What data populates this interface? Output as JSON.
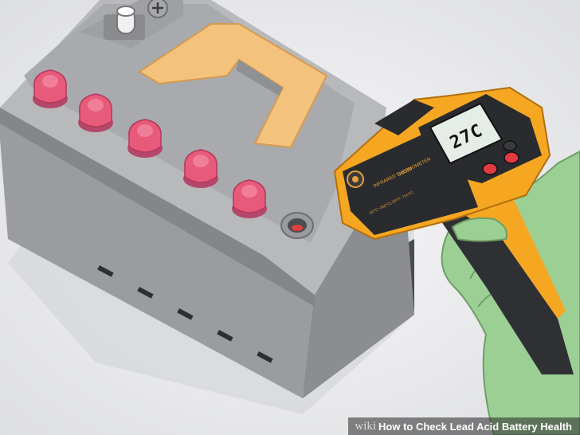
{
  "illustration": {
    "subject": "battery-and-thermometer",
    "colors": {
      "background": "#e9eaec",
      "battery_body": "#a4a5a7",
      "battery_top": "#b7b8ba",
      "cell_caps": "#e85a7a",
      "handle": "#f3c37e",
      "thermometer": "#f6a722",
      "glove": "#9ccf94"
    }
  },
  "thermometer": {
    "display_value": "27C",
    "model": "GM320",
    "label_line1": "INFRARED THERMOMETER",
    "label_line2": "-50°C~380°C(-58°F~716°F)"
  },
  "caption": {
    "logo": "wiki",
    "title": "How to Check Lead Acid Battery Health"
  }
}
